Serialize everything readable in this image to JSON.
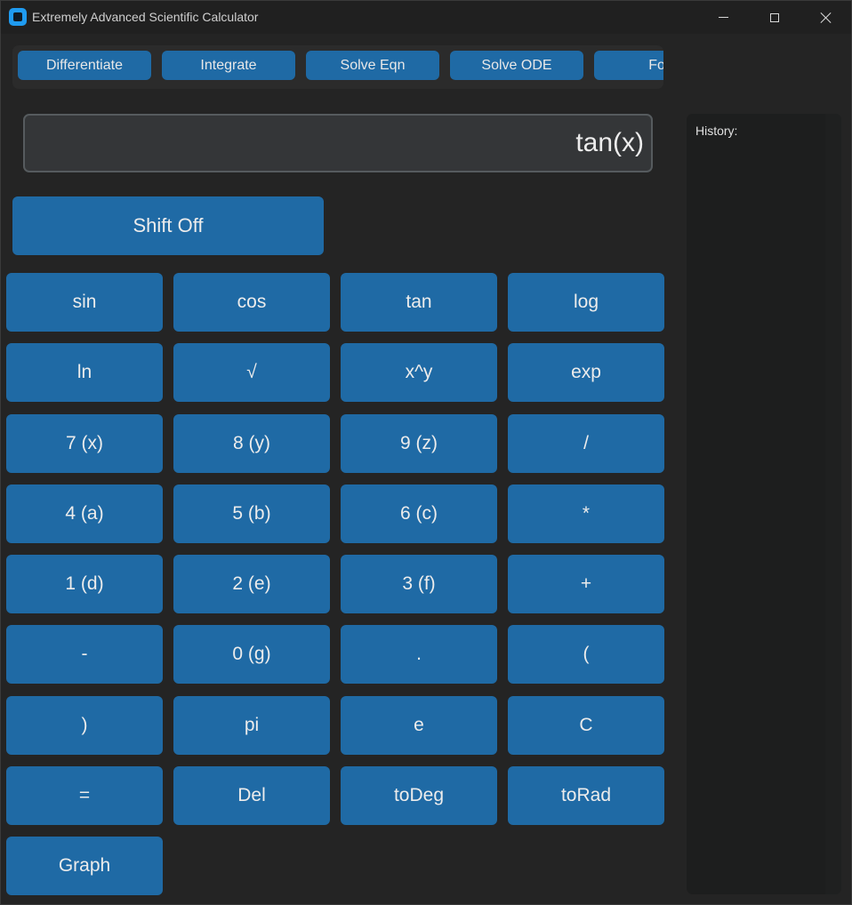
{
  "window": {
    "title": "Extremely Advanced Scientific Calculator"
  },
  "toolbar": {
    "buttons": [
      "Differentiate",
      "Integrate",
      "Solve Eqn",
      "Solve ODE",
      "Fou"
    ]
  },
  "display": {
    "value": "tan(x)"
  },
  "shift": {
    "label": "Shift Off"
  },
  "keypad": {
    "keys": [
      "sin",
      "cos",
      "tan",
      "log",
      "ln",
      "√",
      "x^y",
      "exp",
      "7 (x)",
      "8 (y)",
      "9 (z)",
      "/",
      "4 (a)",
      "5 (b)",
      "6 (c)",
      "*",
      "1 (d)",
      "2 (e)",
      "3 (f)",
      "+",
      "-",
      "0 (g)",
      ".",
      "(",
      ")",
      "pi",
      "e",
      "C",
      "=",
      "Del",
      "toDeg",
      "toRad",
      "Graph"
    ]
  },
  "history": {
    "label": "History:"
  },
  "colors": {
    "background": "#242424",
    "button": "#1f6aa5",
    "display": "#343638",
    "history_panel": "#1d1e1e"
  }
}
